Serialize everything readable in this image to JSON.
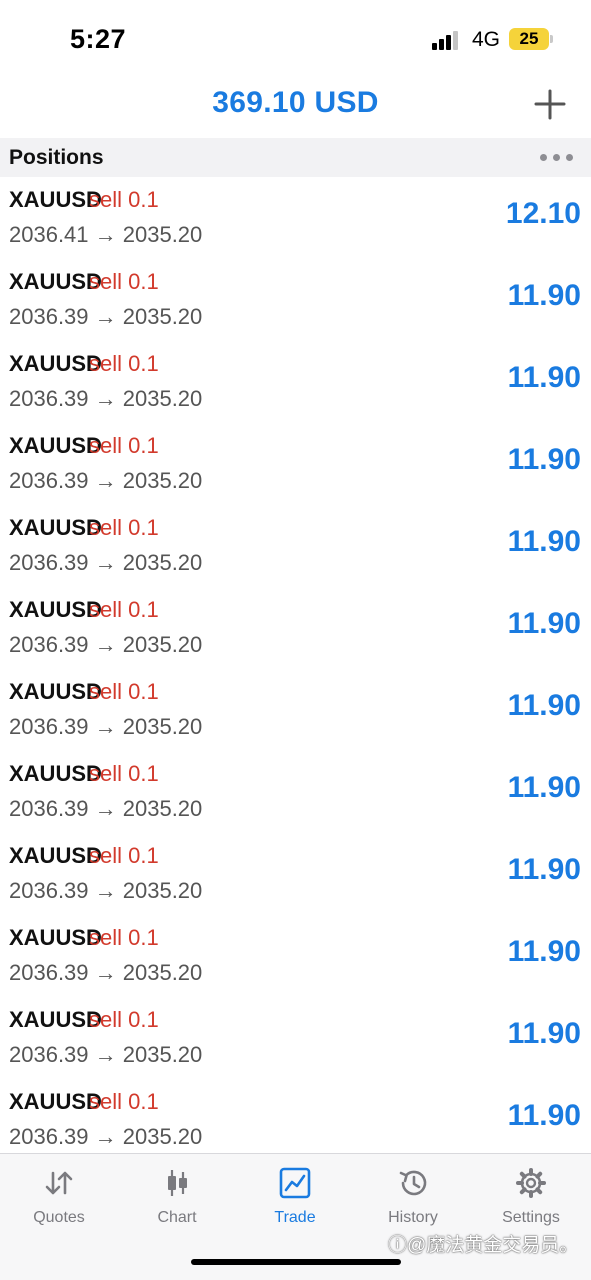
{
  "status_bar": {
    "time": "5:27",
    "network": "4G",
    "battery": "25"
  },
  "header": {
    "balance": "369.10 USD",
    "add_icon": "plus-icon"
  },
  "section": {
    "title": "Positions",
    "more_icon": "ellipsis-icon"
  },
  "positions": [
    {
      "symbol": "XAUUSD",
      "side": "sell 0.1",
      "prices": "2036.41 → 2035.20",
      "profit": "12.10"
    },
    {
      "symbol": "XAUUSD",
      "side": "sell 0.1",
      "prices": "2036.39 → 2035.20",
      "profit": "11.90"
    },
    {
      "symbol": "XAUUSD",
      "side": "sell 0.1",
      "prices": "2036.39 → 2035.20",
      "profit": "11.90"
    },
    {
      "symbol": "XAUUSD",
      "side": "sell 0.1",
      "prices": "2036.39 → 2035.20",
      "profit": "11.90"
    },
    {
      "symbol": "XAUUSD",
      "side": "sell 0.1",
      "prices": "2036.39 → 2035.20",
      "profit": "11.90"
    },
    {
      "symbol": "XAUUSD",
      "side": "sell 0.1",
      "prices": "2036.39 → 2035.20",
      "profit": "11.90"
    },
    {
      "symbol": "XAUUSD",
      "side": "sell 0.1",
      "prices": "2036.39 → 2035.20",
      "profit": "11.90"
    },
    {
      "symbol": "XAUUSD",
      "side": "sell 0.1",
      "prices": "2036.39 → 2035.20",
      "profit": "11.90"
    },
    {
      "symbol": "XAUUSD",
      "side": "sell 0.1",
      "prices": "2036.39 → 2035.20",
      "profit": "11.90"
    },
    {
      "symbol": "XAUUSD",
      "side": "sell 0.1",
      "prices": "2036.39 → 2035.20",
      "profit": "11.90"
    },
    {
      "symbol": "XAUUSD",
      "side": "sell 0.1",
      "prices": "2036.39 → 2035.20",
      "profit": "11.90"
    },
    {
      "symbol": "XAUUSD",
      "side": "sell 0.1",
      "prices": "2036.39 → 2035.20",
      "profit": "11.90"
    }
  ],
  "tabs": [
    {
      "label": "Quotes",
      "icon": "quotes-arrows-icon",
      "active": false
    },
    {
      "label": "Chart",
      "icon": "candlestick-chart-icon",
      "active": false
    },
    {
      "label": "Trade",
      "icon": "trade-chart-icon",
      "active": true
    },
    {
      "label": "History",
      "icon": "history-clock-icon",
      "active": false
    },
    {
      "label": "Settings",
      "icon": "gear-icon",
      "active": false
    }
  ],
  "watermark": "ⓘ@魔法黄金交易员。",
  "colors": {
    "accent": "#1a7be0",
    "sell": "#d23a2c",
    "text": "#111111",
    "muted": "#7a7a7f"
  }
}
